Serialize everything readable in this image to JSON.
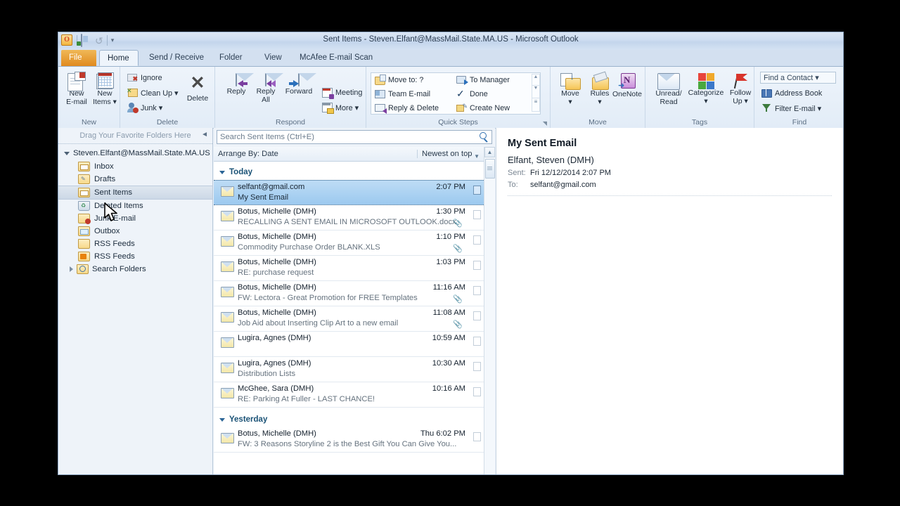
{
  "window": {
    "title": "Sent Items - Steven.Elfant@MassMail.State.MA.US  -  Microsoft Outlook",
    "quick_access": {
      "outlook_letter": "O",
      "send_receive_icon": "send-receive-icon",
      "undo_icon": "↺",
      "customize_icon": "▾"
    }
  },
  "tabs": [
    {
      "label": "File",
      "type": "file"
    },
    {
      "label": "Home",
      "type": "active"
    },
    {
      "label": "Send / Receive",
      "type": "normal"
    },
    {
      "label": "Folder",
      "type": "normal"
    },
    {
      "label": "View",
      "type": "normal"
    },
    {
      "label": "McAfee E-mail Scan",
      "type": "normal"
    }
  ],
  "ribbon": {
    "groups": [
      {
        "name": "New",
        "label": "New"
      },
      {
        "name": "Delete",
        "label": "Delete"
      },
      {
        "name": "Respond",
        "label": "Respond"
      },
      {
        "name": "Quick Steps",
        "label": "Quick Steps"
      },
      {
        "name": "Move",
        "label": "Move"
      },
      {
        "name": "Tags",
        "label": "Tags"
      },
      {
        "name": "Find",
        "label": "Find"
      }
    ],
    "new_group": {
      "new_email_line1": "New",
      "new_email_line2": "E-mail",
      "new_items_line1": "New",
      "new_items_line2": "Items ▾"
    },
    "delete_group": {
      "ignore": "Ignore",
      "clean_up": "Clean Up ▾",
      "junk": "Junk ▾",
      "delete": "Delete"
    },
    "respond_group": {
      "reply": "Reply",
      "reply_all_line1": "Reply",
      "reply_all_line2": "All",
      "forward": "Forward",
      "meeting": "Meeting",
      "more": "More ▾"
    },
    "quick_steps": {
      "move_to": "Move to: ?",
      "team_email": "Team E-mail",
      "reply_delete": "Reply & Delete",
      "to_manager": "To Manager",
      "done": "Done",
      "create_new": "Create New"
    },
    "move_group": {
      "move_line1": "Move",
      "move_line2": "▾",
      "rules_line1": "Rules",
      "rules_line2": "▾",
      "onenote": "OneNote"
    },
    "tags_group": {
      "unread_line1": "Unread/",
      "unread_line2": "Read",
      "categorize_line1": "Categorize",
      "categorize_line2": "▾",
      "followup_line1": "Follow",
      "followup_line2": "Up ▾"
    },
    "find_group": {
      "find_a_contact": "Find a Contact  ▾",
      "address_book": "Address Book",
      "filter_email": "Filter E-mail ▾"
    }
  },
  "nav": {
    "favorites_hint": "Drag Your Favorite Folders Here",
    "collapse_icon": "◄",
    "account": "Steven.Elfant@MassMail.State.MA.US",
    "folders": [
      {
        "label": "Inbox",
        "icon": "inbox-folder-icon",
        "selected": false
      },
      {
        "label": "Drafts",
        "icon": "drafts-folder-icon",
        "selected": false
      },
      {
        "label": "Sent Items",
        "icon": "sent-folder-icon",
        "selected": true
      },
      {
        "label": "Deleted Items",
        "icon": "trash-icon",
        "selected": false
      },
      {
        "label": "Junk E-mail",
        "icon": "junk-folder-icon",
        "selected": false
      },
      {
        "label": "Outbox",
        "icon": "outbox-folder-icon",
        "selected": false
      },
      {
        "label": "RSS Feeds",
        "icon": "folder-icon",
        "selected": false
      },
      {
        "label": "RSS Feeds",
        "icon": "rss-icon",
        "selected": false
      },
      {
        "label": "Search Folders",
        "icon": "search-folder-icon",
        "selected": false
      }
    ]
  },
  "list": {
    "search_placeholder": "Search Sent Items (Ctrl+E)",
    "search_icon": "search-icon",
    "arrange_by": "Arrange By: Date",
    "sort_order": "Newest on top",
    "groups": [
      {
        "label": "Today",
        "messages": [
          {
            "from": "selfant@gmail.com",
            "time": "2:07 PM",
            "subject": "My Sent Email",
            "attachment": false,
            "selected": true
          },
          {
            "from": "Botus, Michelle (DMH)",
            "time": "1:30 PM",
            "subject": "RECALLING A SENT EMAIL IN MICROSOFT OUTLOOK.docx",
            "attachment": true,
            "selected": false
          },
          {
            "from": "Botus, Michelle (DMH)",
            "time": "1:10 PM",
            "subject": "Commodity Purchase Order BLANK.XLS",
            "attachment": true,
            "selected": false
          },
          {
            "from": "Botus, Michelle (DMH)",
            "time": "1:03 PM",
            "subject": "RE: purchase request",
            "attachment": false,
            "selected": false
          },
          {
            "from": "Botus, Michelle (DMH)",
            "time": "11:16 AM",
            "subject": "FW: Lectora - Great Promotion for FREE Templates",
            "attachment": true,
            "selected": false
          },
          {
            "from": "Botus, Michelle (DMH)",
            "time": "11:08 AM",
            "subject": "Job Aid about Inserting Clip Art to a new email",
            "attachment": true,
            "selected": false
          },
          {
            "from": "Lugira, Agnes (DMH)",
            "time": "10:59 AM",
            "subject": "",
            "attachment": false,
            "selected": false
          },
          {
            "from": "Lugira, Agnes (DMH)",
            "time": "10:30 AM",
            "subject": "Distribution Lists",
            "attachment": false,
            "selected": false
          },
          {
            "from": "McGhee, Sara (DMH)",
            "time": "10:16 AM",
            "subject": "RE: Parking At Fuller - LAST CHANCE!",
            "attachment": false,
            "selected": false
          }
        ]
      },
      {
        "label": "Yesterday",
        "messages": [
          {
            "from": "Botus, Michelle (DMH)",
            "time": "Thu 6:02 PM",
            "subject": "FW: 3 Reasons Storyline 2 is the Best Gift You Can Give You...",
            "attachment": false,
            "selected": false
          }
        ]
      }
    ]
  },
  "reading_pane": {
    "subject": "My Sent Email",
    "sender": "Elfant, Steven (DMH)",
    "sent_label": "Sent:",
    "sent_value": "Fri 12/12/2014 2:07 PM",
    "to_label": "To:",
    "to_value": "selfant@gmail.com"
  },
  "colors": {
    "file_tab": "#e08a1e",
    "selection_blue": "#9cc9ef",
    "group_header": "#1a5276",
    "ribbon_bg": "#eef4fb"
  }
}
